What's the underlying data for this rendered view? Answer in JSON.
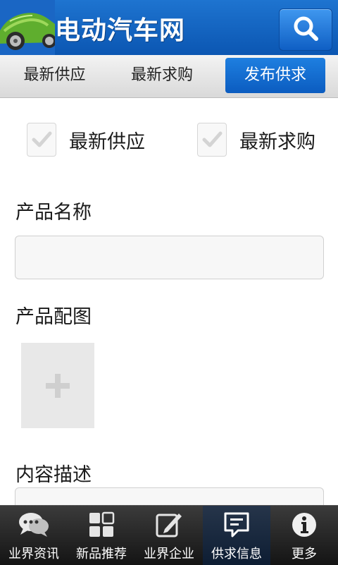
{
  "header": {
    "title": "电动汽车网",
    "search_icon": "search-icon"
  },
  "tabs": [
    {
      "label": "最新供应",
      "active": false
    },
    {
      "label": "最新求购",
      "active": false
    },
    {
      "label": "发布供求",
      "active": true
    }
  ],
  "form": {
    "checkboxes": [
      {
        "label": "最新供应",
        "checked": false
      },
      {
        "label": "最新求购",
        "checked": false
      }
    ],
    "product_name_label": "产品名称",
    "product_name_value": "",
    "product_image_label": "产品配图",
    "content_label": "内容描述",
    "content_value": ""
  },
  "bottom_nav": [
    {
      "label": "业界资讯",
      "icon": "chat-bubbles-icon",
      "active": false
    },
    {
      "label": "新品推荐",
      "icon": "grid-icon",
      "active": false
    },
    {
      "label": "业界企业",
      "icon": "edit-icon",
      "active": false
    },
    {
      "label": "供求信息",
      "icon": "message-icon",
      "active": true
    },
    {
      "label": "更多",
      "icon": "info-icon",
      "active": false
    }
  ],
  "colors": {
    "header_blue": "#1565c8",
    "accent_blue": "#0b5cc0",
    "bottom_bar": "#1e1e1e"
  }
}
